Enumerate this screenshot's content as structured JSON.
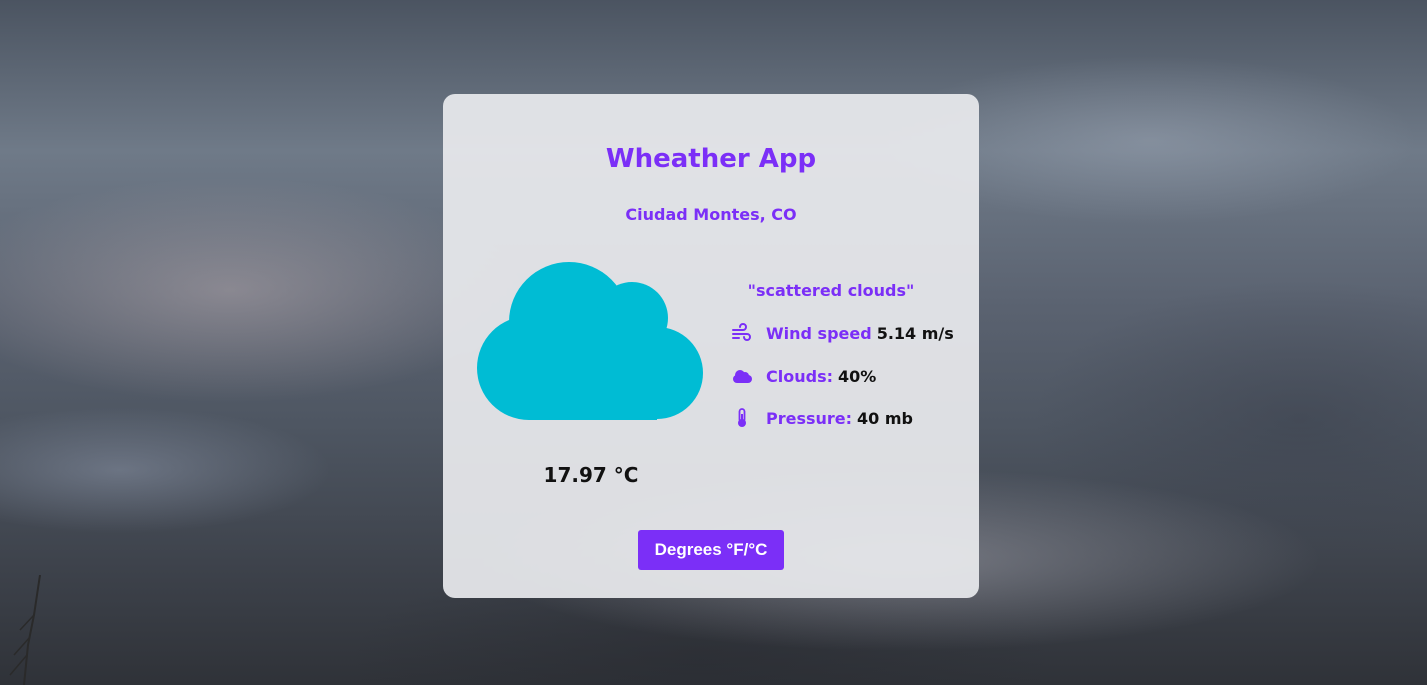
{
  "app": {
    "title": "Wheather App"
  },
  "location": {
    "city": "Ciudad Montes, CO"
  },
  "weather": {
    "icon": "cloud-icon",
    "temperature": "17.97 °C",
    "description": "\"scattered clouds\""
  },
  "stats": {
    "wind": {
      "icon": "wind-icon",
      "label": "Wind speed",
      "value": "5.14 m/s"
    },
    "clouds": {
      "icon": "cloud-icon",
      "label": "Clouds:",
      "value": "40%"
    },
    "pressure": {
      "icon": "thermometer-icon",
      "label": "Pressure:",
      "value": "40 mb"
    }
  },
  "actions": {
    "toggle_units_label": "Degrees °F/°C"
  },
  "colors": {
    "accent": "#7b2ff7",
    "weather_icon": "#00bcd4"
  }
}
